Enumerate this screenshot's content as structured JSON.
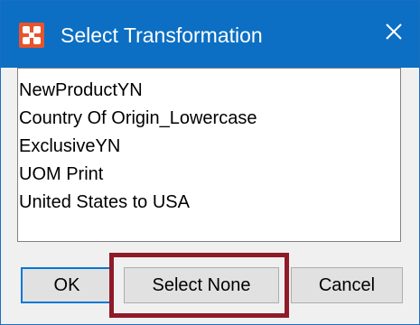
{
  "window": {
    "title": "Select Transformation",
    "icons": {
      "app": "app-logo-icon",
      "close": "close-icon"
    },
    "colors": {
      "titlebar": "#0c6fc3",
      "app_icon": "#e8542d",
      "highlight": "#8f1a28",
      "ok_border": "#0078d7"
    }
  },
  "list": {
    "items": [
      "NewProductYN",
      "Country Of Origin_Lowercase",
      "ExclusiveYN",
      "UOM Print",
      "United States to USA"
    ]
  },
  "buttons": {
    "ok": "OK",
    "select_none": "Select None",
    "cancel": "Cancel"
  }
}
